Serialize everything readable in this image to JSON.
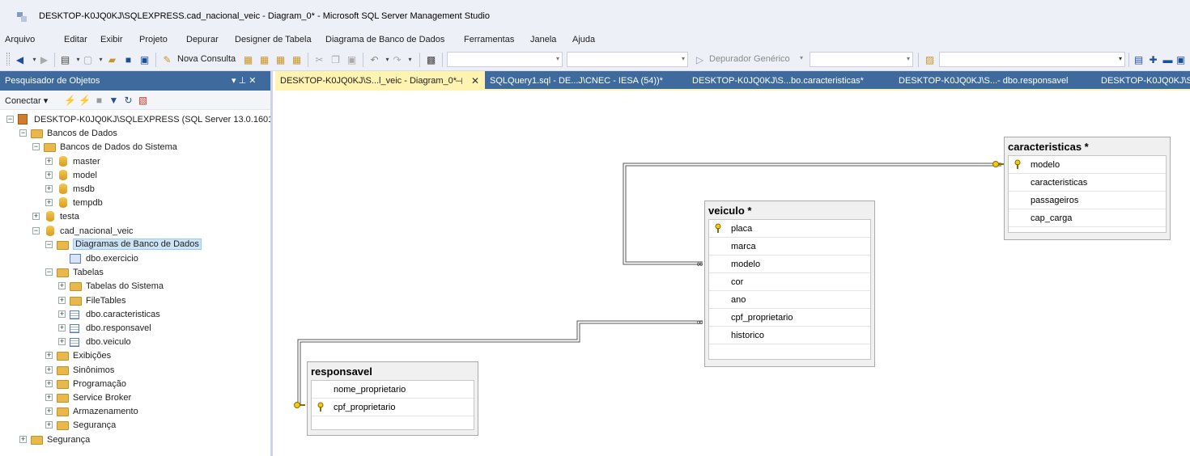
{
  "window": {
    "title": "DESKTOP-K0JQ0KJ\\SQLEXPRESS.cad_nacional_veic - Diagram_0* - Microsoft SQL Server Management Studio"
  },
  "menu": [
    "Arquivo",
    "Editar",
    "Exibir",
    "Projeto",
    "Depurar",
    "Designer de Tabela",
    "Diagrama de Banco de Dados",
    "Ferramentas",
    "Janela",
    "Ajuda"
  ],
  "toolbar": {
    "new_query": "Nova Consulta",
    "debugger": "Depurador Genérico"
  },
  "explorer": {
    "title": "Pesquisador de Objetos",
    "pin": "▾ ⊥ ✕",
    "connect": "Conectar ▾",
    "tree": [
      {
        "label": "DESKTOP-K0JQ0KJ\\SQLEXPRESS (SQL Server 13.0.1601",
        "level": 0,
        "icon": "server-icon",
        "exp": "−"
      },
      {
        "label": "Bancos de Dados",
        "level": 1,
        "icon": "folder-icon",
        "exp": "−"
      },
      {
        "label": "Bancos de Dados do Sistema",
        "level": 2,
        "icon": "folder-icon",
        "exp": "−"
      },
      {
        "label": "master",
        "level": 3,
        "icon": "database-icon",
        "exp": "+"
      },
      {
        "label": "model",
        "level": 3,
        "icon": "database-icon",
        "exp": "+"
      },
      {
        "label": "msdb",
        "level": 3,
        "icon": "database-icon",
        "exp": "+"
      },
      {
        "label": "tempdb",
        "level": 3,
        "icon": "database-icon",
        "exp": "+"
      },
      {
        "label": "testa",
        "level": 2,
        "icon": "database-icon",
        "exp": "+"
      },
      {
        "label": "cad_nacional_veic",
        "level": 2,
        "icon": "database-icon",
        "exp": "−"
      },
      {
        "label": "Diagramas de Banco de Dados",
        "level": 3,
        "icon": "folder-icon",
        "exp": "−",
        "selected": true
      },
      {
        "label": "dbo.exercicio",
        "level": 4,
        "icon": "diagram-icon",
        "exp": ""
      },
      {
        "label": "Tabelas",
        "level": 3,
        "icon": "folder-icon",
        "exp": "−"
      },
      {
        "label": "Tabelas do Sistema",
        "level": 4,
        "icon": "folder-icon",
        "exp": "+"
      },
      {
        "label": "FileTables",
        "level": 4,
        "icon": "folder-icon",
        "exp": "+"
      },
      {
        "label": "dbo.caracteristicas",
        "level": 4,
        "icon": "table-icon",
        "exp": "+"
      },
      {
        "label": "dbo.responsavel",
        "level": 4,
        "icon": "table-icon",
        "exp": "+"
      },
      {
        "label": "dbo.veiculo",
        "level": 4,
        "icon": "table-icon",
        "exp": "+"
      },
      {
        "label": "Exibições",
        "level": 3,
        "icon": "folder-icon",
        "exp": "+"
      },
      {
        "label": "Sinônimos",
        "level": 3,
        "icon": "folder-icon",
        "exp": "+"
      },
      {
        "label": "Programação",
        "level": 3,
        "icon": "folder-icon",
        "exp": "+"
      },
      {
        "label": "Service Broker",
        "level": 3,
        "icon": "folder-icon",
        "exp": "+"
      },
      {
        "label": "Armazenamento",
        "level": 3,
        "icon": "folder-icon",
        "exp": "+"
      },
      {
        "label": "Segurança",
        "level": 3,
        "icon": "folder-icon",
        "exp": "+"
      },
      {
        "label": "Segurança",
        "level": 1,
        "icon": "folder-icon",
        "exp": "+"
      }
    ]
  },
  "tabs": [
    {
      "label": "DESKTOP-K0JQ0KJ\\S...l_veic - Diagram_0*",
      "active": true
    },
    {
      "label": "SQLQuery1.sql - DE...J\\CNEC - IESA (54))*",
      "active": false
    },
    {
      "label": "DESKTOP-K0JQ0KJ\\S...bo.caracteristicas*",
      "active": false
    },
    {
      "label": "DESKTOP-K0JQ0KJ\\S...- dbo.responsavel",
      "active": false
    },
    {
      "label": "DESKTOP-K0JQ0KJ\\S...",
      "active": false
    }
  ],
  "diagram": {
    "tables": [
      {
        "name": "caracteristicas *",
        "columns": [
          {
            "name": "modelo",
            "pk": true
          },
          {
            "name": "caracteristicas",
            "pk": false
          },
          {
            "name": "passageiros",
            "pk": false
          },
          {
            "name": "cap_carga",
            "pk": false
          }
        ]
      },
      {
        "name": "veiculo *",
        "columns": [
          {
            "name": "placa",
            "pk": true
          },
          {
            "name": "marca",
            "pk": false
          },
          {
            "name": "modelo",
            "pk": false
          },
          {
            "name": "cor",
            "pk": false
          },
          {
            "name": "ano",
            "pk": false
          },
          {
            "name": "cpf_proprietario",
            "pk": false
          },
          {
            "name": "historico",
            "pk": false
          }
        ]
      },
      {
        "name": "responsavel",
        "columns": [
          {
            "name": "nome_proprietario",
            "pk": false
          },
          {
            "name": "cpf_proprietario",
            "pk": true
          }
        ]
      }
    ]
  }
}
